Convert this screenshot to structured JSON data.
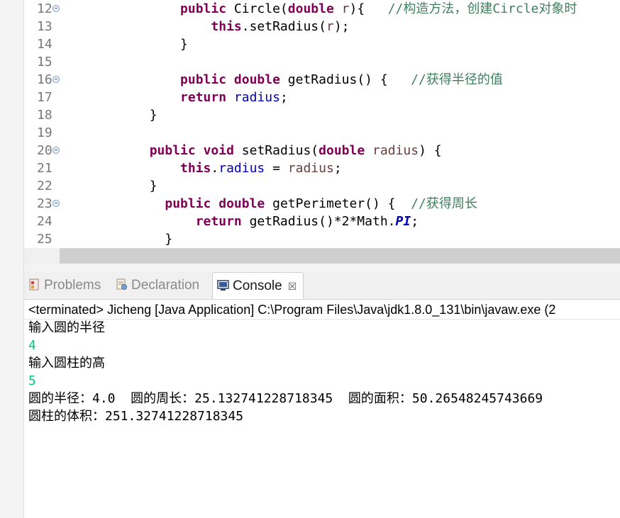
{
  "editor": {
    "lines": [
      {
        "num": "12",
        "fold": true,
        "tokens": [
          {
            "t": "            ",
            "c": ""
          },
          {
            "t": "public",
            "c": "kw"
          },
          {
            "t": " Circle(",
            "c": ""
          },
          {
            "t": "double",
            "c": "kw"
          },
          {
            "t": " ",
            "c": ""
          },
          {
            "t": "r",
            "c": "param"
          },
          {
            "t": "){   ",
            "c": ""
          },
          {
            "t": "//构造方法，创建Circle对象时",
            "c": "cmt"
          }
        ]
      },
      {
        "num": "13",
        "fold": false,
        "tokens": [
          {
            "t": "                ",
            "c": ""
          },
          {
            "t": "this",
            "c": "kw"
          },
          {
            "t": ".setRadius(",
            "c": ""
          },
          {
            "t": "r",
            "c": "param"
          },
          {
            "t": ");",
            "c": ""
          }
        ]
      },
      {
        "num": "14",
        "fold": false,
        "tokens": [
          {
            "t": "            }",
            "c": ""
          }
        ]
      },
      {
        "num": "15",
        "fold": false,
        "tokens": []
      },
      {
        "num": "16",
        "fold": true,
        "tokens": [
          {
            "t": "            ",
            "c": ""
          },
          {
            "t": "public",
            "c": "kw"
          },
          {
            "t": " ",
            "c": ""
          },
          {
            "t": "double",
            "c": "kw"
          },
          {
            "t": " getRadius() {   ",
            "c": ""
          },
          {
            "t": "//获得半径的值",
            "c": "cmt"
          }
        ]
      },
      {
        "num": "17",
        "fold": false,
        "tokens": [
          {
            "t": "            ",
            "c": ""
          },
          {
            "t": "return",
            "c": "kw"
          },
          {
            "t": " ",
            "c": ""
          },
          {
            "t": "radius",
            "c": "field"
          },
          {
            "t": ";",
            "c": ""
          }
        ]
      },
      {
        "num": "18",
        "fold": false,
        "tokens": [
          {
            "t": "        }",
            "c": ""
          }
        ]
      },
      {
        "num": "19",
        "fold": false,
        "tokens": []
      },
      {
        "num": "20",
        "fold": true,
        "tokens": [
          {
            "t": "        ",
            "c": ""
          },
          {
            "t": "public",
            "c": "kw"
          },
          {
            "t": " ",
            "c": ""
          },
          {
            "t": "void",
            "c": "kw"
          },
          {
            "t": " setRadius(",
            "c": ""
          },
          {
            "t": "double",
            "c": "kw"
          },
          {
            "t": " ",
            "c": ""
          },
          {
            "t": "radius",
            "c": "param"
          },
          {
            "t": ") {",
            "c": ""
          }
        ]
      },
      {
        "num": "21",
        "fold": false,
        "tokens": [
          {
            "t": "            ",
            "c": ""
          },
          {
            "t": "this",
            "c": "kw"
          },
          {
            "t": ".",
            "c": ""
          },
          {
            "t": "radius",
            "c": "field"
          },
          {
            "t": " = ",
            "c": ""
          },
          {
            "t": "radius",
            "c": "param"
          },
          {
            "t": ";",
            "c": ""
          }
        ]
      },
      {
        "num": "22",
        "fold": false,
        "tokens": [
          {
            "t": "        }",
            "c": ""
          }
        ]
      },
      {
        "num": "23",
        "fold": true,
        "tokens": [
          {
            "t": "          ",
            "c": ""
          },
          {
            "t": "public",
            "c": "kw"
          },
          {
            "t": " ",
            "c": ""
          },
          {
            "t": "double",
            "c": "kw"
          },
          {
            "t": " getPerimeter() {  ",
            "c": ""
          },
          {
            "t": "//获得周长",
            "c": "cmt"
          }
        ]
      },
      {
        "num": "24",
        "fold": false,
        "tokens": [
          {
            "t": "              ",
            "c": ""
          },
          {
            "t": "return",
            "c": "kw"
          },
          {
            "t": " getRadius()*2*Math.",
            "c": ""
          },
          {
            "t": "PI",
            "c": "const"
          },
          {
            "t": ";",
            "c": ""
          }
        ]
      },
      {
        "num": "25",
        "fold": false,
        "tokens": [
          {
            "t": "          }",
            "c": ""
          }
        ]
      }
    ],
    "scroll_left_arrow": "‹"
  },
  "tabs": {
    "problems": "Problems",
    "declaration": "Declaration",
    "console": "Console",
    "close": "☒"
  },
  "console": {
    "terminated": "<terminated> Jicheng [Java Application] C:\\Program Files\\Java\\jdk1.8.0_131\\bin\\javaw.exe (2",
    "lines": [
      {
        "text": "输入圆的半径",
        "input": false
      },
      {
        "text": "4",
        "input": true
      },
      {
        "text": "输入圆柱的高",
        "input": false
      },
      {
        "text": "5",
        "input": true
      },
      {
        "text": "圆的半径：4.0  圆的周长：25.132741228718345  圆的面积：50.26548245743669",
        "input": false
      },
      {
        "text": "圆柱的体积：251.32741228718345",
        "input": false
      }
    ]
  },
  "colors": {
    "keyword": "#7f0055",
    "field": "#0000c0",
    "comment": "#3f7f5f",
    "user_input": "#00c87f"
  }
}
